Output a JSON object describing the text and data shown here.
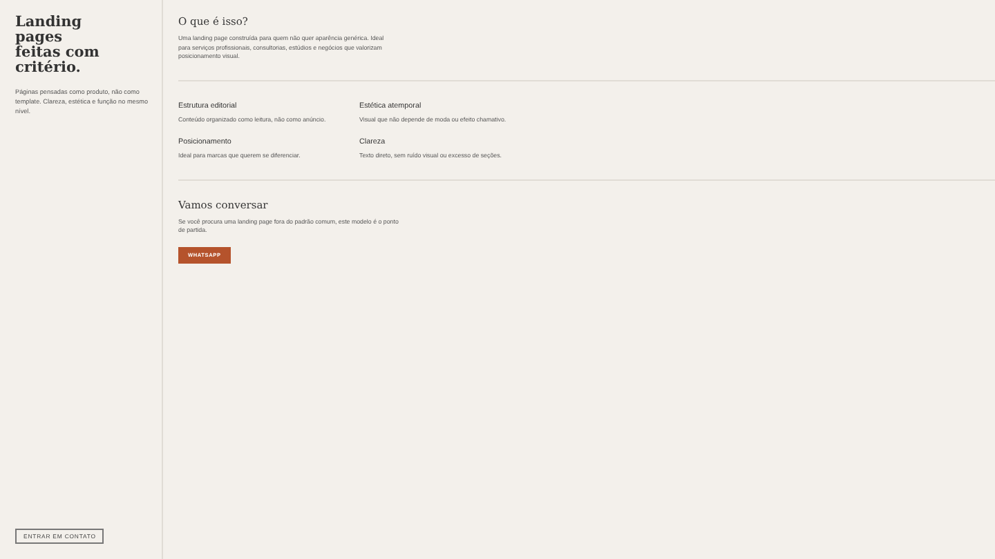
{
  "sidebar": {
    "title": "Landing pages feitas com critério.",
    "description": "Páginas pensadas como produto, não como template. Clareza, estética e função no mesmo nível.",
    "contact_button": "ENTRAR EM CONTATO"
  },
  "about": {
    "heading": "O que é isso?",
    "text": "Uma landing page construída para quem não quer aparência genérica. Ideal para serviços profissionais, consultorias, estúdios e negócios que valorizam posicionamento visual."
  },
  "features": [
    {
      "title": "Estrutura editorial",
      "text": "Conteúdo organizado como leitura, não como anúncio."
    },
    {
      "title": "Estética atemporal",
      "text": "Visual que não depende de moda ou efeito chamativo."
    },
    {
      "title": "Posicionamento",
      "text": "Ideal para marcas que querem se diferenciar."
    },
    {
      "title": "Clareza",
      "text": "Texto direto, sem ruído visual ou excesso de seções."
    }
  ],
  "contact": {
    "heading": "Vamos conversar",
    "text": "Se você procura uma landing page fora do padrão comum, este modelo é o ponto de partida.",
    "button": "WHATSAPP"
  }
}
